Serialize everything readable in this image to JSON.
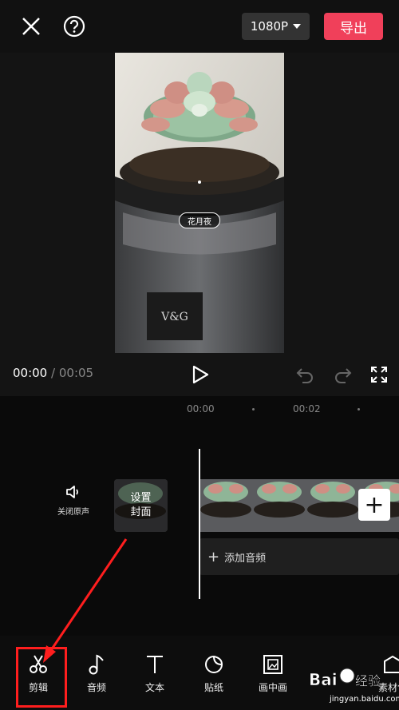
{
  "topbar": {
    "resolution": "1080P",
    "export_label": "导出"
  },
  "preview": {
    "caption_chip": "花月夜",
    "time_current": "00:00",
    "time_separator": "/",
    "time_total": "00:05"
  },
  "timeline": {
    "ruler_labels": [
      "00:00",
      "00:02"
    ],
    "mute_label": "关闭原声",
    "cover_label_line1": "设置",
    "cover_label_line2": "封面",
    "add_clip_symbol": "+",
    "add_audio_label": "添加音频"
  },
  "toolbar": {
    "items": [
      {
        "label": "剪辑",
        "icon": "scissors-icon"
      },
      {
        "label": "音频",
        "icon": "music-note-icon"
      },
      {
        "label": "文本",
        "icon": "text-icon"
      },
      {
        "label": "贴纸",
        "icon": "sticker-icon"
      },
      {
        "label": "画中画",
        "icon": "picture-in-picture-icon"
      },
      {
        "label": "素材包",
        "icon": "material-pack-icon"
      }
    ]
  },
  "watermark": {
    "brand": "Baidu经验",
    "url": "jingyan.baidu.com"
  },
  "colors": {
    "export_red": "#f0405a",
    "highlight_red": "#ff1e1e",
    "background": "#0d0d0d"
  }
}
